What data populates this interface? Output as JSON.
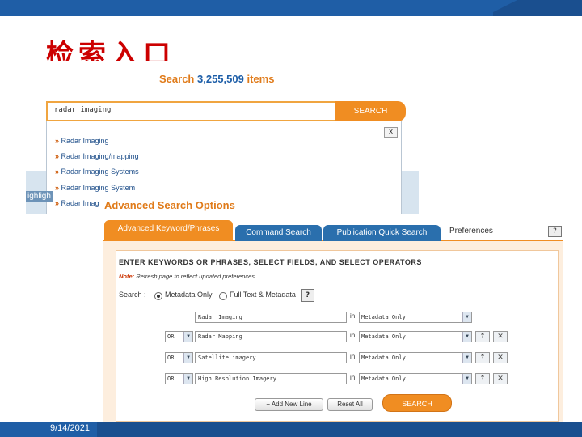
{
  "slide": {
    "title": "检索入口",
    "footer_date": "9/14/2021"
  },
  "quick_search": {
    "heading_prefix": "Search",
    "heading_count": "3,255,509",
    "heading_suffix": "items",
    "input_value": "radar imaging",
    "button_label": "SEARCH",
    "close_label": "x",
    "suggestions": [
      "Radar Imaging",
      "Radar Imaging/mapping",
      "Radar Imaging Systems",
      "Radar Imaging System",
      "Radar Imag"
    ],
    "bg_fragment": "ighligh"
  },
  "advanced": {
    "title": "Advanced Search Options",
    "tabs": [
      "Advanced Keyword/Phrases",
      "Command Search",
      "Publication Quick Search",
      "Preferences"
    ],
    "help_label": "?",
    "heading": "ENTER KEYWORDS OR PHRASES, SELECT FIELDS, AND SELECT OPERATORS",
    "note_label": "Note:",
    "note_text": "Refresh page to reflect updated preferences.",
    "search_label": "Search :",
    "radio_metadata": "Metadata Only",
    "radio_fulltext": "Full Text & Metadata",
    "in_label": "in",
    "rows": [
      {
        "operator": "",
        "term": "Radar Imaging",
        "field": "Metadata Only"
      },
      {
        "operator": "OR",
        "term": "Radar Mapping",
        "field": "Metadata Only"
      },
      {
        "operator": "OR",
        "term": "Satellite imagery",
        "field": "Metadata Only"
      },
      {
        "operator": "OR",
        "term": "High Resolution Imagery",
        "field": "Metadata Only"
      }
    ],
    "add_line_label": "+ Add New Line",
    "reset_label": "Reset All",
    "search_label_btn": "SEARCH"
  },
  "colors": {
    "accent_orange": "#f08d22",
    "brand_blue": "#1a4f8f",
    "title_red": "#cc0000"
  }
}
